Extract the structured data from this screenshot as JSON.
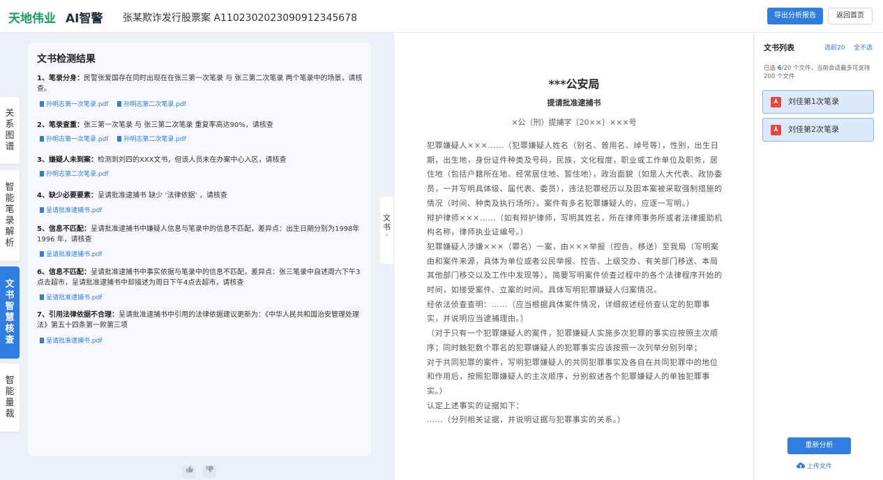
{
  "header": {
    "logo_text": "天地伟业",
    "logo_sub": "AI智警",
    "case_title": "张某欺诈发行股票案 A1102302023090912345678",
    "export_label": "导出分析报告",
    "home_label": "返回首页"
  },
  "side_tabs": [
    "关系图谱",
    "智能笔录解析",
    "文书智慧核查",
    "智能量裁"
  ],
  "results": {
    "title": "文书检测结果",
    "items": [
      {
        "head": "1、笔录分身：",
        "text": "民警张爱国存在同时出现在在张三第一次笔录 与 张三第二次笔录 两个笔录中的场景，请核查。",
        "files": [
          "孙明志第一次笔录.pdf",
          "孙明志第二次笔录.pdf"
        ]
      },
      {
        "head": "2、笔录查重：",
        "text": "张三第一次笔录 与 张三第二次笔录 重复率高达90%，请核查",
        "files": [
          "孙明志第一次笔录.pdf",
          "孙明志第二次笔录.pdf"
        ]
      },
      {
        "head": "3、嫌疑人未到案：",
        "text": "检测到刘四的XXX文书，但该人员未在办案中心入区，请核查",
        "files": [
          "孙明志第二次笔录.pdf"
        ]
      },
      {
        "head": "4、缺少必要要素：",
        "text": "呈请批准逮捕书 缺少 ‘法律依据’ ，请核查",
        "files": [
          "呈请批准逮捕书.pdf"
        ]
      },
      {
        "head": "5、信息不匹配：",
        "text": "呈请批准逮捕书中嫌疑人信息与笔录中的信息不匹配，差异点：出生日期分别为1998年 1996 年，请核查",
        "files": [
          "呈请批准逮捕书.pdf"
        ]
      },
      {
        "head": "6、信息不匹配：",
        "text": "呈请批准逮捕书中事实依据与笔录中的信息不匹配，差异点：张三笔录中自述周六下午3点去超市，呈请批准逮捕书中却描述为周日下午4点去超市，请核查",
        "files": [
          "呈请批准逮捕书.pdf"
        ]
      },
      {
        "head": "7、引用法律依据不合理：",
        "text": "呈请批准逮捕书中引用的法律依据建议更新为：《中华人民共和国治安管理处理法》第五十四条第一款第三项",
        "files": [
          "呈请批准逮捕书.pdf"
        ]
      }
    ]
  },
  "feedback": {
    "like_icon": "thumbs-up-icon",
    "dislike_icon": "thumbs-down-icon"
  },
  "fold_tab": {
    "label": "文书"
  },
  "document": {
    "org": "***公安局",
    "title": "提请批准逮捕书",
    "doc_number": "×公（刑）提捕字〔20××〕×××号",
    "body": [
      "犯罪嫌疑人×××……（犯罪嫌疑人姓名（别名、曾用名、绰号等），性别，出生日期，出生地，身份证件种类及号码，民族，文化程度，职业或工作单位及职务，居住地（包括户籍所在地、经常居住地、暂住地），政治面貌（如是人大代表、政协委员，一并写明具体级、届代表、委员），违法犯罪经历以及因本案被采取强制措施的情况（时间、种类及执行场所）。案件有多名犯罪嫌疑人的，应逐一写明。）",
      "辩护律师×××……（如有辩护律师，写明其姓名，所在律师事务所或者法律援助机构名称，律师执业证编号。）",
      "犯罪嫌疑人涉嫌×××（罪名）一案，由×××举报（控告、移送）至我局（写明案由和案件来源，具体为单位或者公民举报、控告、上级交办、有关部门移送、本局其他部门移交以及工作中发现等）。简要写明案件侦查过程中的各个法律程序开始的时间，如接受案件、立案的时间。具体写明犯罪嫌疑人归案情况。",
      "经依法侦查查明：……（应当根据具体案件情况，详细叙述经侦查认定的犯罪事实，并说明应当逮捕理由。）",
      "（对于只有一个犯罪嫌疑人的案件，犯罪嫌疑人实施多次犯罪的事实应按照主次顺序；同时触犯数个罪名的犯罪嫌疑人的犯罪事实应该按照一次列举分别列举；",
      "对于共同犯罪的案件，写明犯罪嫌疑人的共同犯罪事实及各自在共同犯罪中的地位和作用后，按照犯罪嫌疑人的主次顺序，分别叙述各个犯罪嫌疑人的单独犯罪事实。）",
      "认定上述事实的证据如下：",
      "……（分列相关证据，并说明证据与犯罪事实的关系。）"
    ]
  },
  "file_list": {
    "title": "文书列表",
    "select_first": "选前20",
    "deselect_all": "全不选",
    "note_prefix": "已选 ",
    "selected_count": "6",
    "note_suffix": "/20 个文件，当前会话最多可支持 200 个文件",
    "files": [
      "刘佳第1次笔录",
      "刘佳第2次笔录"
    ],
    "reanalyze_label": "重新分析",
    "upload_label": "上传文件"
  }
}
